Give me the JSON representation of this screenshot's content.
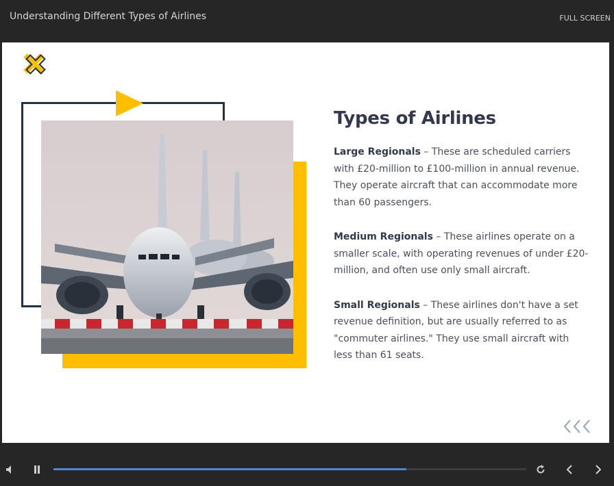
{
  "header": {
    "course_title": "Understanding Different Types of Airlines",
    "fullscreen_label": "FULL SCREEN"
  },
  "slide": {
    "heading": "Types of Airlines",
    "sections": [
      {
        "term": "Large Regionals",
        "text": " – These are scheduled carriers with £20-million to £100-million in annual revenue. They operate aircraft that can accommodate more than 60 passengers."
      },
      {
        "term": "Medium Regionals",
        "text": " – These airlines operate on a smaller scale, with operating revenues of under £20-million, and often use only small aircraft."
      },
      {
        "term": "Small Regionals",
        "text": " – These airlines don't have a set revenue definition, but are usually referred to as \"commuter airlines.\" They use small aircraft with less than 61 seats."
      }
    ],
    "accent_color": "#ffbf00",
    "frame_color": "#1e3347"
  },
  "player": {
    "progress_fraction": 0.746,
    "progress_color": "#4f86d6",
    "icons": [
      "volume-icon",
      "pause-icon",
      "replay-icon",
      "previous-icon",
      "next-icon"
    ]
  }
}
